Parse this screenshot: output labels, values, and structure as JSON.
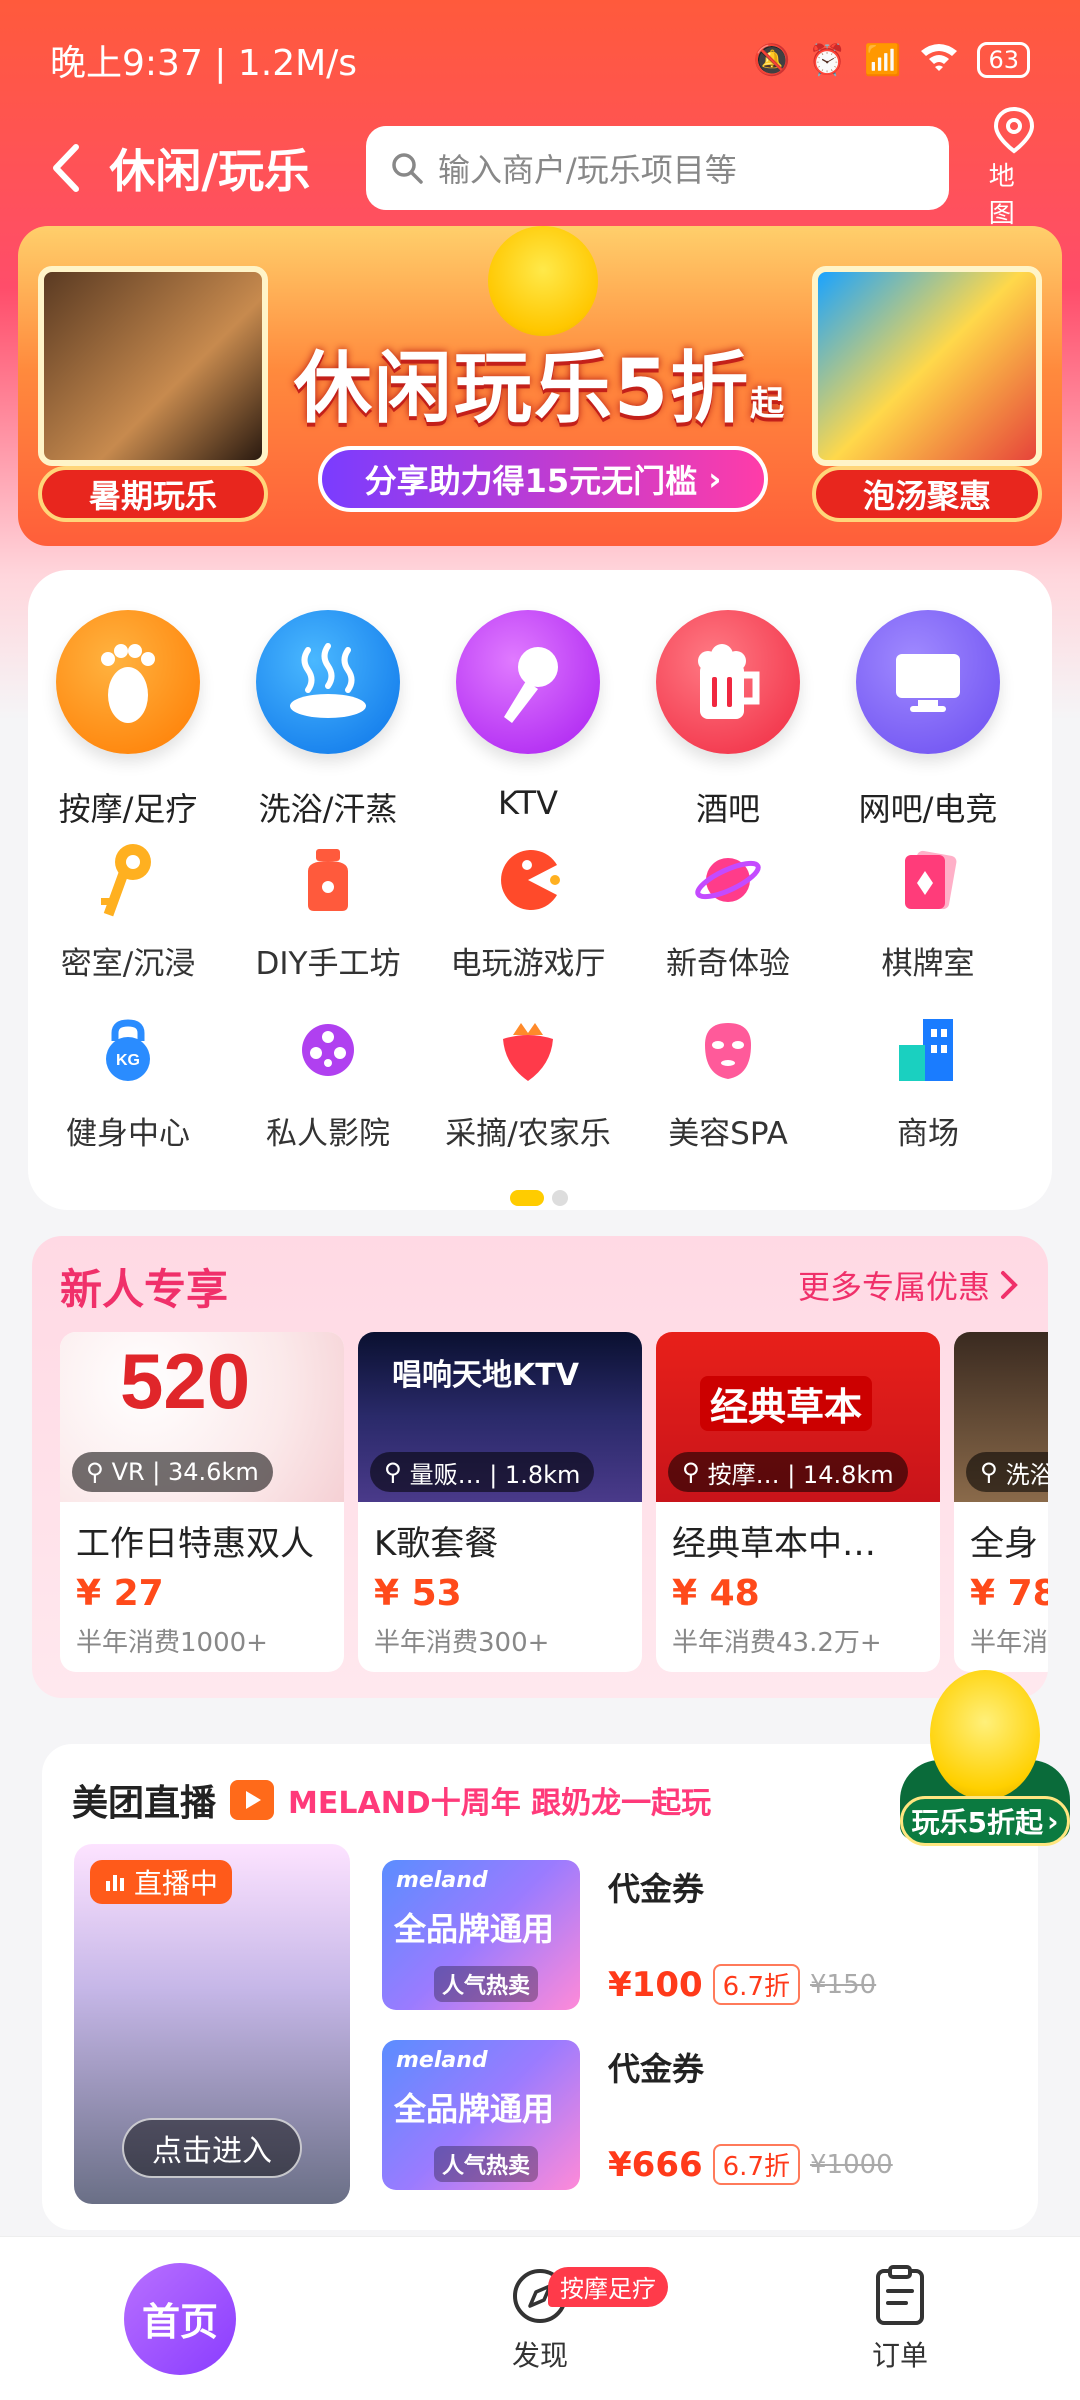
{
  "status_bar": {
    "time": "晚上9:37 | 1.2M/s",
    "battery": "63"
  },
  "header": {
    "title": "休闲/玩乐",
    "search_placeholder": "输入商户/玩乐项目等",
    "map_label": "地图"
  },
  "banner": {
    "headline": "休闲玩乐5折",
    "headline_suffix": "起",
    "subline": "分享助力得15元无门槛",
    "left_tag": "暑期玩乐",
    "right_tag": "泡汤聚惠"
  },
  "categories": {
    "big": [
      {
        "label": "按摩/足疗",
        "color": "#ff8a00",
        "icon": "foot-icon"
      },
      {
        "label": "洗浴/汗蒸",
        "color": "#1a8cff",
        "icon": "hot-spring-icon"
      },
      {
        "label": "KTV",
        "color": "#c13cff",
        "icon": "microphone-icon"
      },
      {
        "label": "酒吧",
        "color": "#ff4a5a",
        "icon": "beer-mug-icon"
      },
      {
        "label": "网吧/电竞",
        "color": "#7a5cff",
        "icon": "monitor-icon"
      }
    ],
    "small_row1": [
      {
        "label": "密室/沉浸",
        "icon": "key-icon"
      },
      {
        "label": "DIY手工坊",
        "icon": "jar-icon"
      },
      {
        "label": "电玩游戏厅",
        "icon": "pacman-icon"
      },
      {
        "label": "新奇体验",
        "icon": "planet-icon"
      },
      {
        "label": "棋牌室",
        "icon": "card-icon"
      }
    ],
    "small_row2": [
      {
        "label": "健身中心",
        "icon": "kettlebell-icon"
      },
      {
        "label": "私人影院",
        "icon": "film-reel-icon"
      },
      {
        "label": "采摘/农家乐",
        "icon": "strawberry-icon"
      },
      {
        "label": "美容SPA",
        "icon": "face-mask-icon"
      },
      {
        "label": "商场",
        "icon": "building-icon"
      }
    ]
  },
  "new_user": {
    "title": "新人专享",
    "more": "更多专属优惠",
    "deals": [
      {
        "location": "VR | 34.6km",
        "name": "工作日特惠双人",
        "price": "¥ 27",
        "sales": "半年消费1000+"
      },
      {
        "location": "量贩… | 1.8km",
        "name": "K歌套餐",
        "price": "¥ 53",
        "sales": "半年消费300+"
      },
      {
        "location": "按摩… | 14.8km",
        "name": "经典草本中…",
        "price": "¥ 48",
        "sales": "半年消费43.2万+"
      },
      {
        "location": "洗浴",
        "name": "全身",
        "price": "¥ 78",
        "sales": "半年消"
      }
    ],
    "deal_images": {
      "img1": "520",
      "img2": "唱响天地KTV",
      "img3": "经典草本"
    }
  },
  "live": {
    "title": "美团直播",
    "slogan": "MELAND十周年 跟奶龙一起玩",
    "badge": "直播中",
    "enter": "点击进入",
    "coupons": [
      {
        "name": "代金券",
        "price": "¥100",
        "discount": "6.7折",
        "original": "¥150",
        "img_text": "全品牌通用",
        "img_sub": "人气热卖",
        "brand": "meland"
      },
      {
        "name": "代金券",
        "price": "¥666",
        "discount": "6.7折",
        "original": "¥1000",
        "img_text": "全品牌通用",
        "img_sub": "人气热卖",
        "brand": "meland"
      }
    ]
  },
  "float_promo": {
    "label": "玩乐5折起"
  },
  "bottom_nav": {
    "home": "首页",
    "discover": "发现",
    "discover_badge": "按摩足疗",
    "orders": "订单"
  }
}
